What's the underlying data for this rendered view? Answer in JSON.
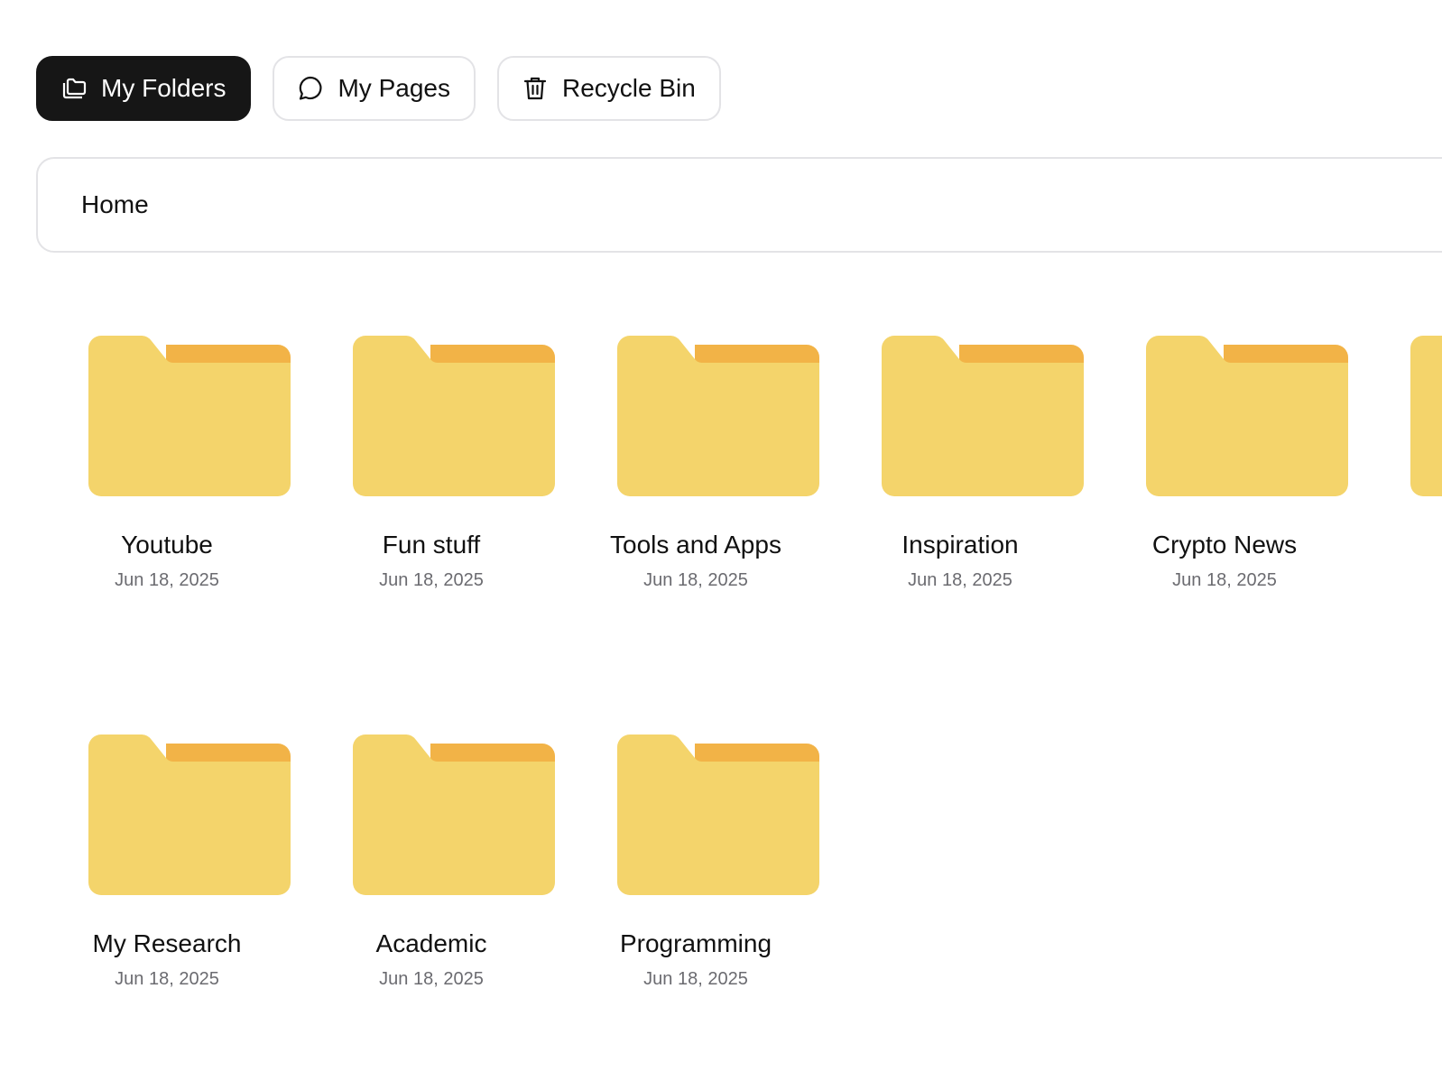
{
  "tabs": [
    {
      "label": "My Folders",
      "icon": "folders-icon",
      "active": true
    },
    {
      "label": "My Pages",
      "icon": "chat-bubble-icon",
      "active": false
    },
    {
      "label": "Recycle Bin",
      "icon": "trash-icon",
      "active": false
    }
  ],
  "breadcrumb": {
    "current": "Home"
  },
  "folders": [
    {
      "name": "Youtube",
      "date": "Jun 18, 2025"
    },
    {
      "name": "Fun stuff",
      "date": "Jun 18, 2025"
    },
    {
      "name": "Tools and Apps",
      "date": "Jun 18, 2025"
    },
    {
      "name": "Inspiration",
      "date": "Jun 18, 2025"
    },
    {
      "name": "Crypto News",
      "date": "Jun 18, 2025"
    },
    {
      "name": "",
      "date": ""
    },
    {
      "name": "My Research",
      "date": "Jun 18, 2025"
    },
    {
      "name": "Academic",
      "date": "Jun 18, 2025"
    },
    {
      "name": "Programming",
      "date": "Jun 18, 2025"
    }
  ],
  "colors": {
    "folder_body": "#F4D46B",
    "folder_tab": "#F2B347",
    "active_tab_bg": "#161616",
    "border": "#E3E3E6",
    "date_text": "#6B6B70"
  }
}
